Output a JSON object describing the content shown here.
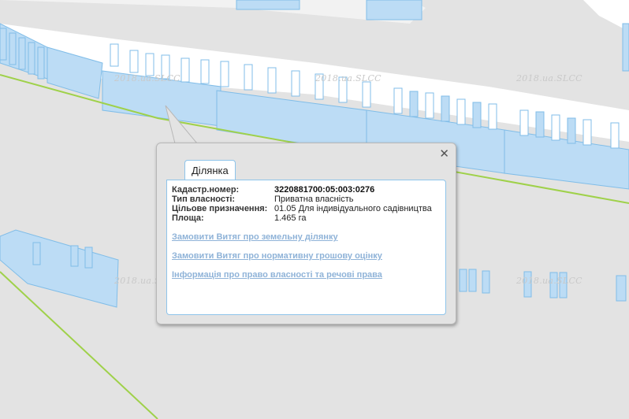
{
  "map": {
    "watermark": "2018.ua.SLCC",
    "colors": {
      "background": "#e3e3e3",
      "parcel_fill": "#bcdcf5",
      "parcel_stroke": "#80bde8",
      "river_fill": "#ffffff",
      "boundary_line": "#9fd14a"
    }
  },
  "popup": {
    "tab_title": "Ділянка",
    "close_icon": "close-icon",
    "fields": [
      {
        "label": "Кадастр.номер:",
        "value": "3220881700:05:003:0276"
      },
      {
        "label": "Тип власності:",
        "value": "Приватна власність"
      },
      {
        "label": "Цільове призначення:",
        "value": "01.05 Для індивідуального садівництва"
      },
      {
        "label": "Площа:",
        "value": "1.465 га"
      }
    ],
    "links": [
      {
        "text": "Замовити Витяг про земельну ділянку"
      },
      {
        "text": "Замовити Витяг про нормативну грошову оцінку"
      },
      {
        "text": "Інформація про право власності та речові права"
      }
    ]
  }
}
